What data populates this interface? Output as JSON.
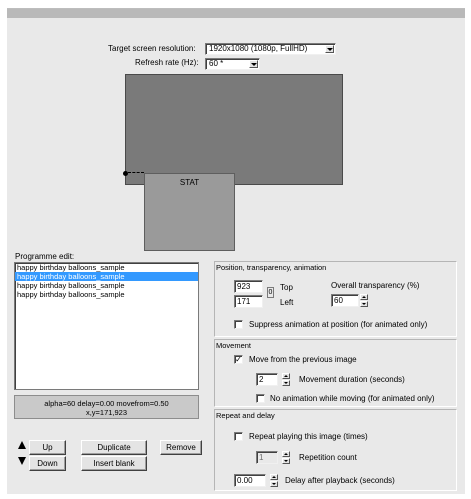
{
  "resolution": {
    "label": "Target screen resolution:",
    "value": "1920x1080 (1080p, FullHD)"
  },
  "refresh": {
    "label": "Refresh rate (Hz):",
    "value": "60 *"
  },
  "preview": {
    "stat_label": "STAT"
  },
  "programme": {
    "label": "Programme edit:",
    "items": [
      "happy birthday balloons_sample",
      "happy birthday balloons_sample",
      "happy birthday balloons_sample",
      "happy birthday balloons_sample"
    ],
    "status_line1": "alpha=60  delay=0.00  movefrom=0.50",
    "status_line2": "x,y=171,923"
  },
  "buttons": {
    "up": "Up",
    "down": "Down",
    "duplicate": "Duplicate",
    "insert_blank": "Insert blank",
    "remove": "Remove"
  },
  "position_group": {
    "title": "Position, transparency, animation",
    "top_value": "923",
    "top_label": "Top",
    "zero_label": "0",
    "left_value": "171",
    "left_label": "Left",
    "transparency_label": "Overall transparency (%)",
    "transparency_value": "60",
    "suppress_label": "Suppress animation at position (for animated only)"
  },
  "movement_group": {
    "title": "Movement",
    "move_from_label": "Move from the previous image",
    "move_from_mark": "✓",
    "duration_value": "2",
    "duration_label": "Movement duration (seconds)",
    "no_animation_label": "No animation while moving (for animated only)"
  },
  "repeat_group": {
    "title": "Repeat and delay",
    "repeat_label": "Repeat playing this image (times)",
    "repetition_value": "1",
    "repetition_label": "Repetition count",
    "delay_value": "0.00",
    "delay_label": "Delay after playback (seconds)"
  },
  "colors": {
    "selection": "#3399ff",
    "window_bg": "#e9e9e9",
    "screen_preview": "#7a7a7a"
  }
}
